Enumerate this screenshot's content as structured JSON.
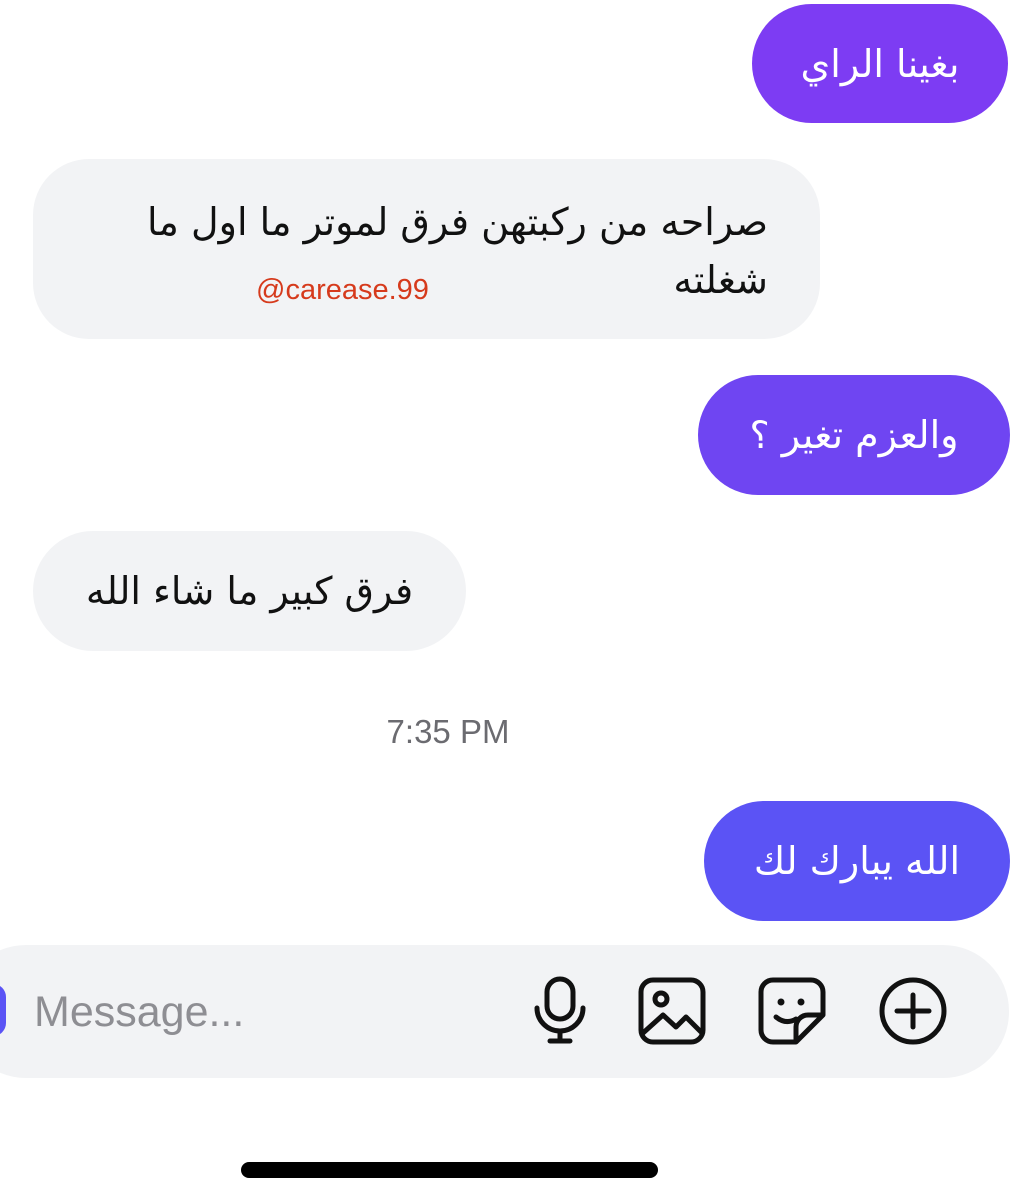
{
  "messages": [
    {
      "direction": "outgoing",
      "text": "بغينا الراي",
      "color": "#7d3cf3"
    },
    {
      "direction": "incoming",
      "lines": [
        "صراحه من ركبتهن فرق لموتر ما اول ما",
        "شغلته"
      ],
      "overlay": "@carease.99"
    },
    {
      "direction": "outgoing",
      "text": "والعزم تغير ؟",
      "color": "#6f45f2"
    },
    {
      "direction": "incoming",
      "text": "فرق كبير ما شاء الله"
    },
    {
      "direction": "outgoing",
      "text": "الله يبارك لك",
      "color": "#5b53f5"
    }
  ],
  "timestamp": "7:35 PM",
  "composer": {
    "placeholder": "Message...",
    "icons": [
      "microphone-icon",
      "image-icon",
      "sticker-icon",
      "plus-circle-icon"
    ]
  },
  "colors": {
    "incoming_bubble": "#f2f3f5",
    "watermark": "#d63a1c",
    "timestamp": "#6b6b70"
  }
}
